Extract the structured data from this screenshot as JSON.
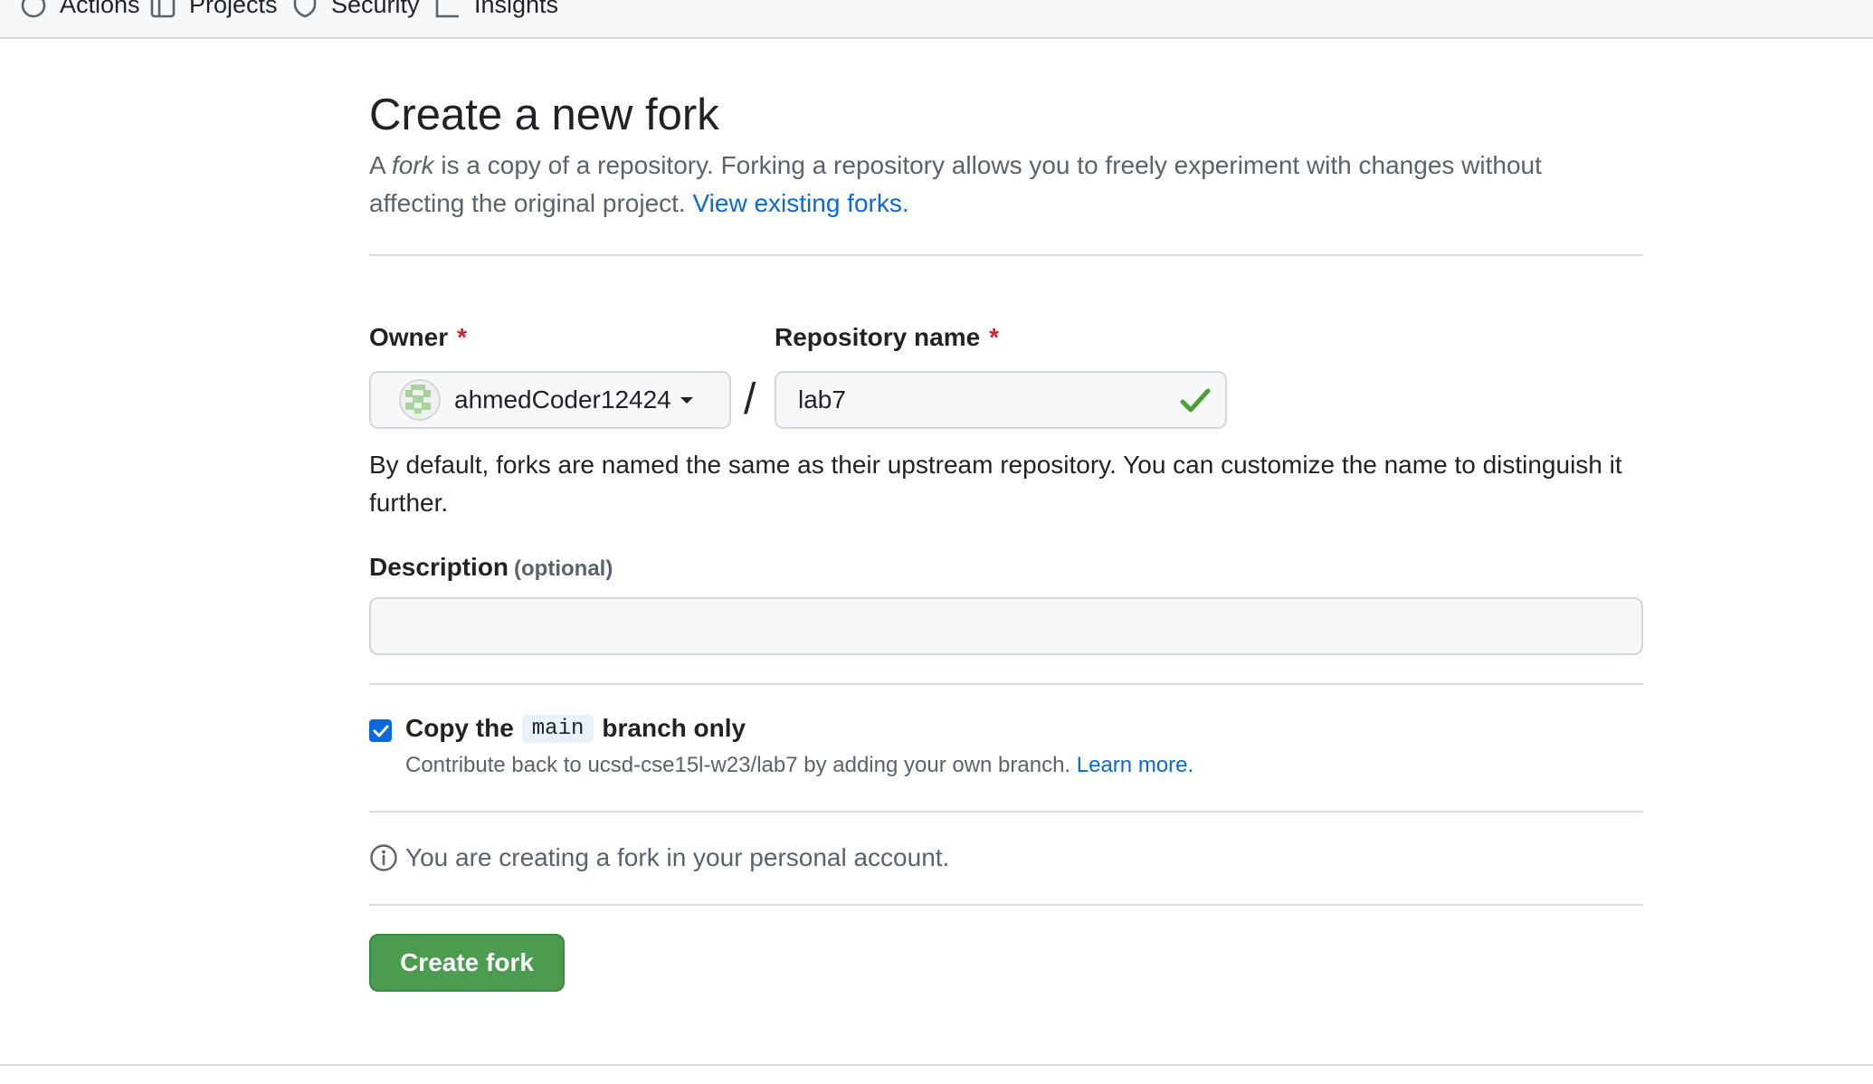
{
  "nav": {
    "items": [
      {
        "label": "Actions",
        "icon": "play-circle-icon"
      },
      {
        "label": "Projects",
        "icon": "table-icon"
      },
      {
        "label": "Security",
        "icon": "shield-icon"
      },
      {
        "label": "Insights",
        "icon": "graph-icon"
      }
    ]
  },
  "page": {
    "title": "Create a new fork",
    "intro_prefix": "A ",
    "intro_em": "fork",
    "intro_text": " is a copy of a repository. Forking a repository allows you to freely experiment with changes without affecting the original project. ",
    "intro_link": "View existing forks."
  },
  "form": {
    "owner_label": "Owner",
    "required_mark": "*",
    "owner_value": "ahmedCoder12424",
    "separator": "/",
    "repo_label": "Repository name",
    "repo_value": "lab7",
    "help_text": "By default, forks are named the same as their upstream repository. You can customize the name to distinguish it further.",
    "description_label": "Description",
    "description_optional": "(optional)",
    "description_value": "",
    "copy_label_prefix": "Copy the",
    "copy_branch": "main",
    "copy_label_suffix": "branch only",
    "copy_checked": true,
    "copy_note": "Contribute back to ucsd-cse15l-w23/lab7 by adding your own branch.",
    "copy_note_link": "Learn more.",
    "info_text": "You are creating a fork in your personal account.",
    "submit_label": "Create fork"
  },
  "colors": {
    "accent_blue": "#0969da",
    "button_green": "#4b9c4f",
    "required_red": "#cf222e",
    "check_green": "#4c9f38"
  }
}
